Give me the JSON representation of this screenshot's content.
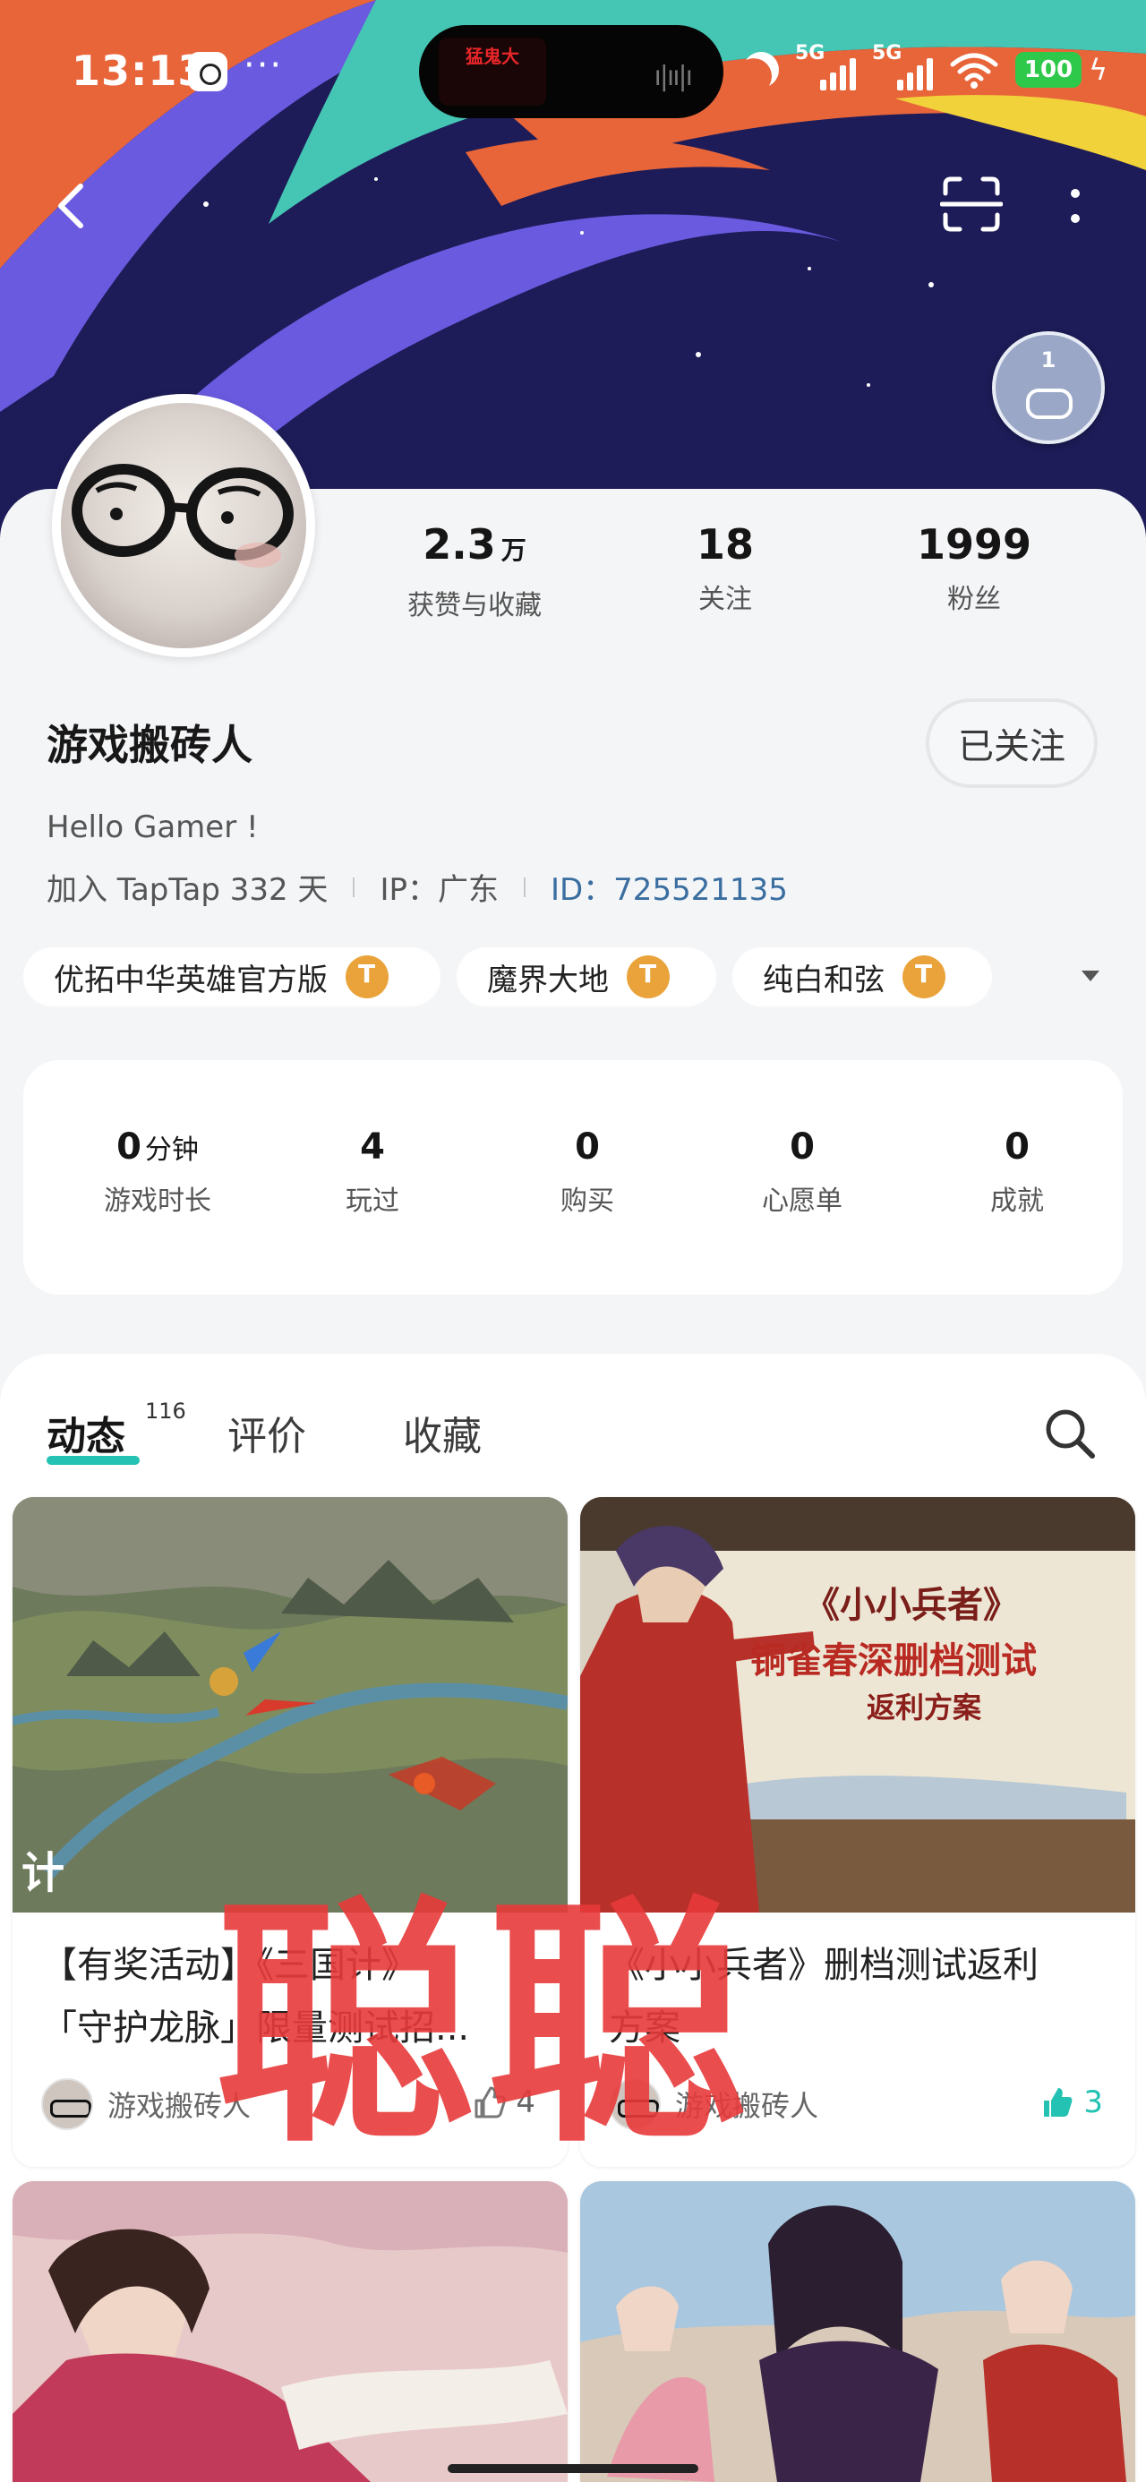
{
  "status_bar": {
    "time": "13:13",
    "network_1": "5G",
    "network_2": "5G",
    "battery": "100",
    "island_thumbnail_text": "猛鬼大"
  },
  "profile": {
    "username": "游戏搬砖人",
    "follow_label": "已关注",
    "bio": "Hello Gamer !",
    "joined": "加入 TapTap 332 天",
    "ip": "IP：广东",
    "id": "ID：725521135",
    "badge_level": "1",
    "stats": [
      {
        "value": "2.3",
        "unit": "万",
        "label": "获赞与收藏"
      },
      {
        "value": "18",
        "unit": "",
        "label": "关注"
      },
      {
        "value": "1999",
        "unit": "",
        "label": "粉丝"
      }
    ]
  },
  "games": [
    {
      "name": "优拓中华英雄官方版",
      "badge": "T4"
    },
    {
      "name": "魔界大地",
      "badge": "T4"
    },
    {
      "name": "纯白和弦",
      "badge": "T4"
    }
  ],
  "play_stats": [
    {
      "value": "0",
      "unit": "分钟",
      "label": "游戏时长"
    },
    {
      "value": "4",
      "unit": "",
      "label": "玩过"
    },
    {
      "value": "0",
      "unit": "",
      "label": "购买"
    },
    {
      "value": "0",
      "unit": "",
      "label": "心愿单"
    },
    {
      "value": "0",
      "unit": "",
      "label": "成就"
    }
  ],
  "tabs": [
    {
      "label": "动态",
      "count": "116"
    },
    {
      "label": "评价"
    },
    {
      "label": "收藏"
    }
  ],
  "posts": [
    {
      "title_line1": "【有奖活动】《三国计》",
      "title_line2": "「守护龙脉」限量测试招...",
      "author": "游戏搬砖人",
      "likes": "4",
      "liked": false,
      "image_text": "计"
    },
    {
      "title_line1": "《小小兵者》删档测试返利",
      "title_line2": "方案",
      "author": "游戏搬砖人",
      "likes": "3",
      "liked": true,
      "image_text_1": "《小小兵者》",
      "image_text_2": "铜雀春深删档测试",
      "image_text_3": "返利方案"
    }
  ],
  "watermark": "聪聪",
  "colors": {
    "accent": "#23c2b2",
    "link": "#3a6ea0",
    "badge": "#e9a33a",
    "watermark": "#e83a3a"
  }
}
